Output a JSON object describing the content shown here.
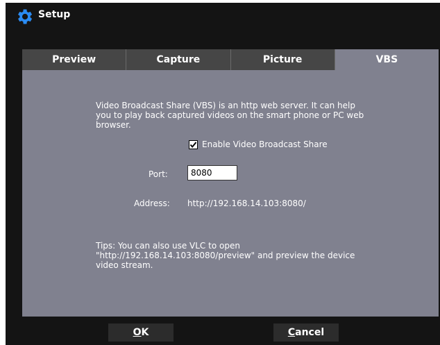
{
  "window": {
    "title": "Setup"
  },
  "tabs": [
    {
      "label": "Preview"
    },
    {
      "label": "Capture"
    },
    {
      "label": "Picture"
    },
    {
      "label": "VBS"
    }
  ],
  "vbs": {
    "description_line1": "Video Broadcast Share (VBS) is an http web server. It can help",
    "description_line2": "you to play back captured videos on the smart phone or PC web",
    "description_line3": "browser.",
    "enable_label": "Enable Video Broadcast Share",
    "enable_checked": true,
    "port_label": "Port:",
    "port_value": "8080",
    "address_label": "Address:",
    "address_value": "http://192.168.14.103:8080/",
    "tips_line1": "Tips:  You can also use VLC to open",
    "tips_line2": "\"http://192.168.14.103:8080/preview\" and preview the device",
    "tips_line3": "video stream."
  },
  "buttons": {
    "ok_first": "O",
    "ok_rest": "K",
    "cancel_first": "C",
    "cancel_rest": "ancel"
  },
  "colors": {
    "window_bg": "#141414",
    "panel_bg": "#80818f",
    "tab_inactive": "#464646",
    "gear_icon": "#1e90ff"
  }
}
